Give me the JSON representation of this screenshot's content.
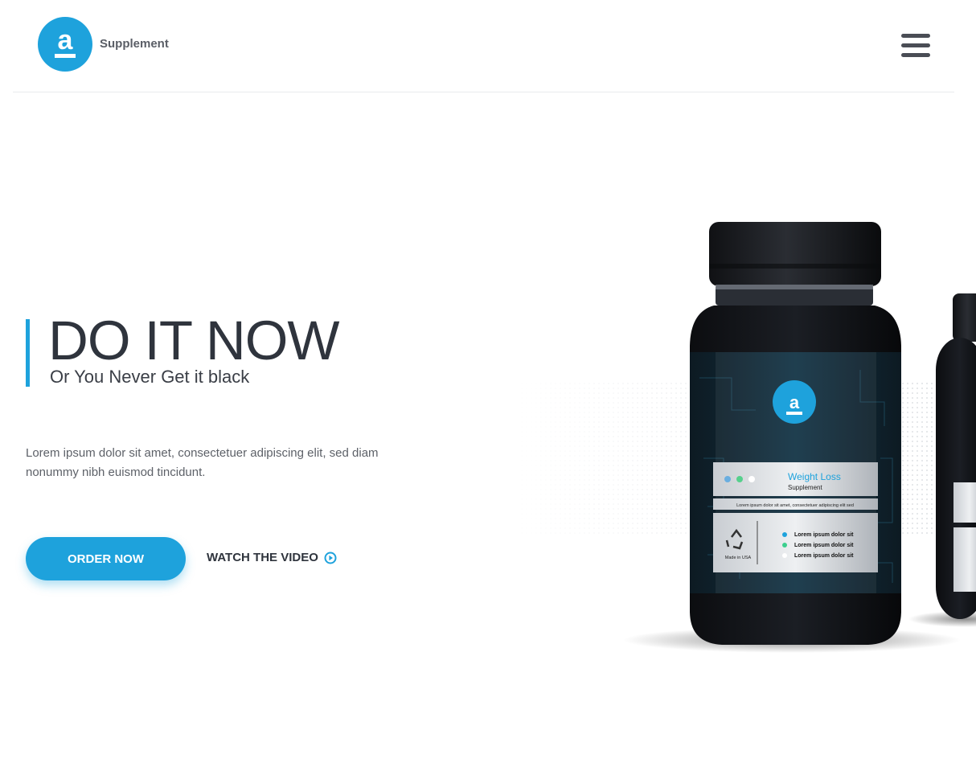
{
  "header": {
    "logo_icon": "letter-a-logo-icon",
    "brand_name": "Supplement",
    "menu_icon": "hamburger-menu-icon"
  },
  "hero": {
    "title": "DO IT NOW",
    "subtitle": "Or You Never Get it black",
    "description": "Lorem ipsum dolor sit amet, consectetuer adipiscing elit, sed diam nonummy nibh euismod tincidunt.",
    "order_button": "ORDER NOW",
    "watch_link": "WATCH THE VIDEO",
    "watch_icon": "play-circle-icon"
  },
  "product": {
    "label_title": "Weight Loss",
    "label_subtitle": "Supplement",
    "label_tagline": "Lorem ipsum dolor sit amet, consectetuer adipiscing elit sed",
    "label_origin": "Made in USA",
    "label_bullets": [
      "Lorem ipsum dolor sit",
      "Lorem ipsum dolor sit",
      "Lorem ipsum dolor sit"
    ],
    "recycle_icon": "recycle-icon"
  },
  "colors": {
    "accent": "#1ea2dc",
    "text_dark": "#2f343d",
    "text_body": "#5d6168",
    "bullet_green": "#3ccf8e"
  }
}
